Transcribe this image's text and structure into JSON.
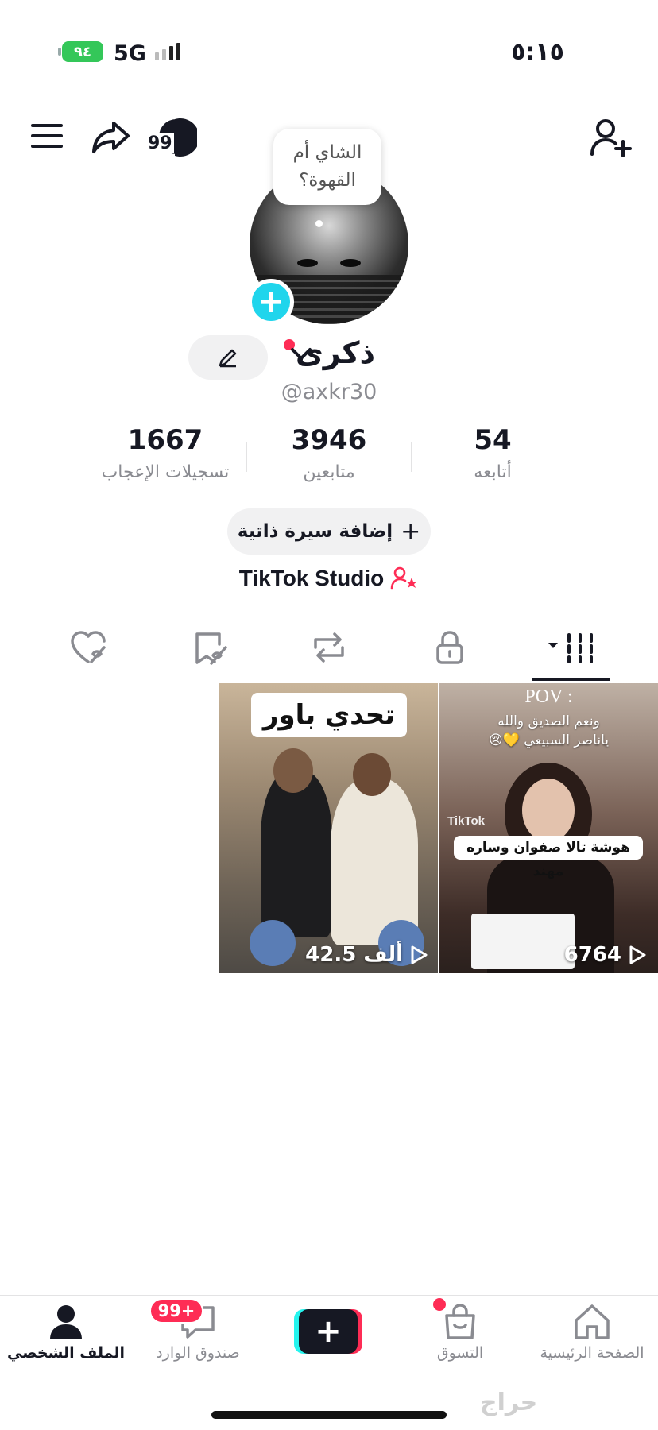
{
  "status_bar": {
    "time": "٥:١٥",
    "battery": "٩٤",
    "network": "5G"
  },
  "profile": {
    "note": "الشاي أم\nالقهوة؟",
    "display_name": "ذكرى",
    "handle": "@axkr30",
    "stats": {
      "likes": {
        "value": "1667",
        "label": "تسجيلات الإعجاب"
      },
      "followers": {
        "value": "3946",
        "label": "متابعين"
      },
      "following": {
        "value": "54",
        "label": "أتابعه"
      }
    },
    "add_bio_label": "إضافة سيرة ذاتية",
    "add_bio_plus": "+",
    "studio_label": "TikTok Studio",
    "follow_requests": "99"
  },
  "videos": [
    {
      "caption": "تحدي باور",
      "views": "42.5 ألف"
    },
    {
      "header": "POV :",
      "subheader": "ونعم الصديق والله\nياناصر السبيعي 💛😢",
      "caption": "هوشة تالا صفوان وساره مهند",
      "watermark": "TikTok",
      "views": "6764"
    }
  ],
  "nav": {
    "home": "الصفحة الرئيسية",
    "shop": "التسوق",
    "create": "+",
    "inbox": "صندوق الوارد",
    "inbox_badge": "99+",
    "profile": "الملف الشخصي"
  },
  "watermark": "حراج",
  "colors": {
    "accent": "#fe2c55",
    "cyan": "#25f4ee",
    "plus_badge": "#20d5ec",
    "battery": "#34c759"
  }
}
